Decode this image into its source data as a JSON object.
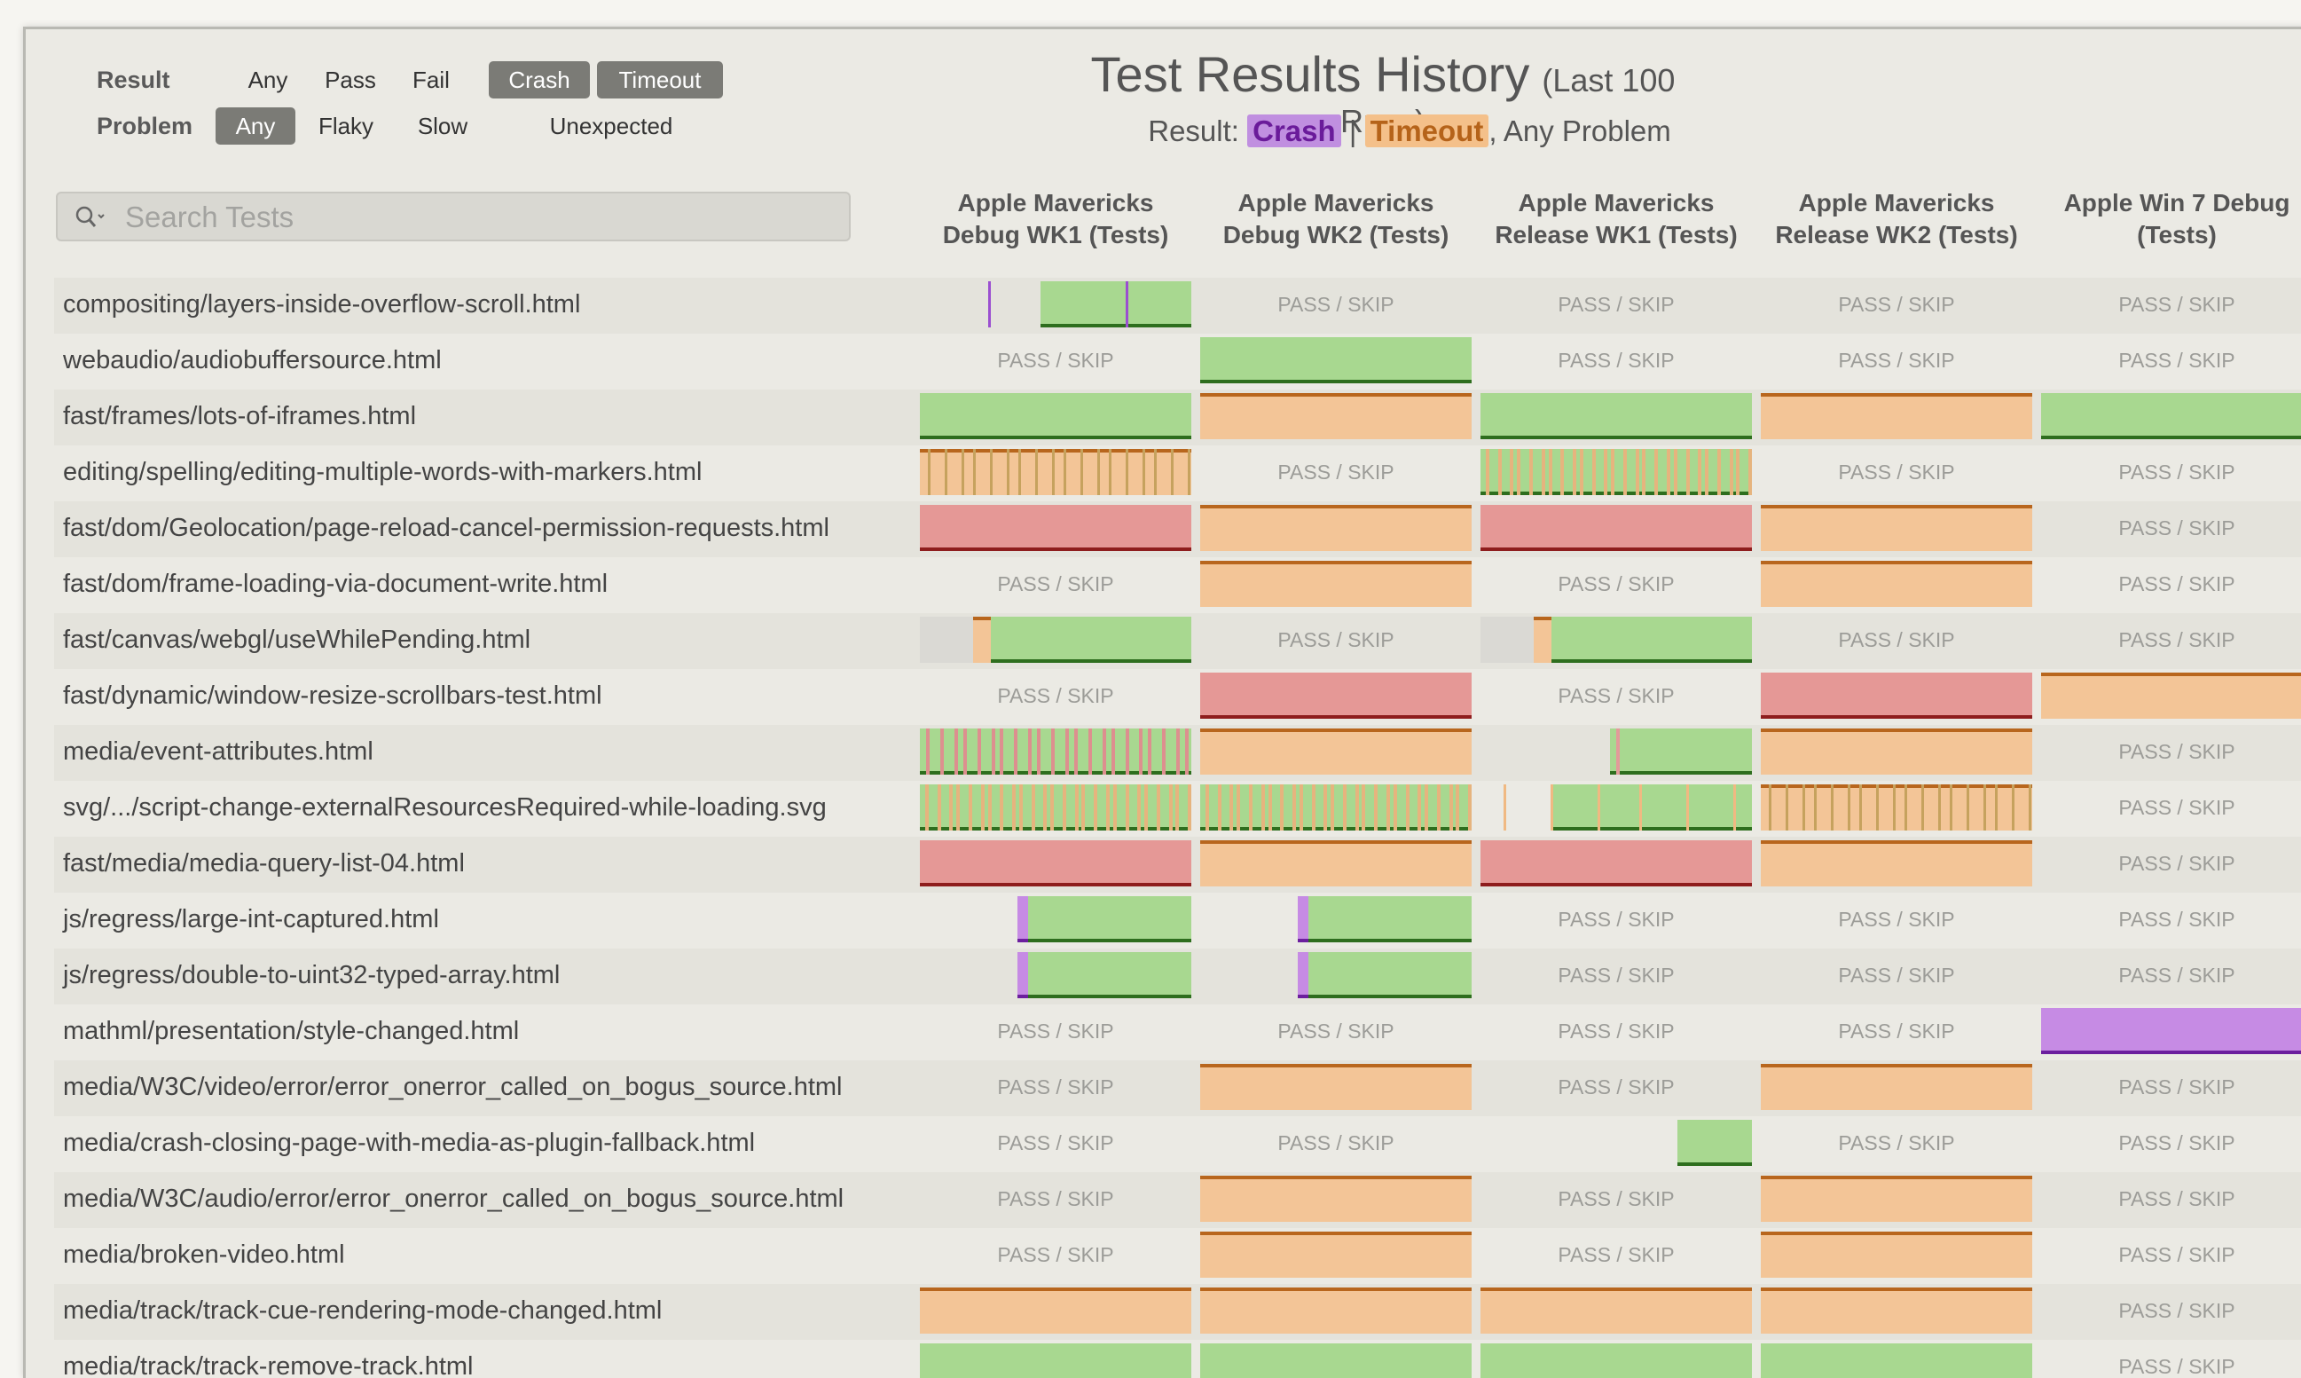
{
  "filters": {
    "result_label": "Result",
    "result_options": [
      "Any",
      "Pass",
      "Fail",
      "Crash",
      "Timeout"
    ],
    "result_selected": [
      "Crash",
      "Timeout"
    ],
    "problem_label": "Problem",
    "problem_options": [
      "Any",
      "Flaky",
      "Slow",
      "Unexpected"
    ],
    "problem_selected": [
      "Any"
    ]
  },
  "header": {
    "title": "Test Results History",
    "title_sub": "(Last 100 Runs)",
    "summary_prefix": "Result:",
    "summary_crash": "Crash",
    "summary_sep": "|",
    "summary_timeout": "Timeout",
    "summary_suffix": ", Any Problem"
  },
  "search": {
    "placeholder": "Search Tests"
  },
  "columns": [
    [
      "Apple Mavericks",
      "Debug WK1 (Tests)"
    ],
    [
      "Apple Mavericks",
      "Debug WK2 (Tests)"
    ],
    [
      "Apple Mavericks",
      "Release WK1 (Tests)"
    ],
    [
      "Apple Mavericks",
      "Release WK2 (Tests)"
    ],
    [
      "Apple Win 7 Debug",
      "(Tests)"
    ]
  ],
  "pass_skip_label": "PASS / SKIP",
  "colors": {
    "green": "#a8d890",
    "orange": "#f3c597",
    "red": "#e59896",
    "purple": "#c68be4",
    "gray": "#dad9d4"
  },
  "tests": [
    {
      "name": "compositing/layers-inside-overflow-scroll.html",
      "cells": [
        "green-late",
        "skip",
        "skip",
        "skip",
        "skip"
      ]
    },
    {
      "name": "webaudio/audiobuffersource.html",
      "cells": [
        "skip",
        "green",
        "skip",
        "skip",
        "skip"
      ]
    },
    {
      "name": "fast/frames/lots-of-iframes.html",
      "cells": [
        "green",
        "orange",
        "green",
        "orange",
        "green"
      ]
    },
    {
      "name": "editing/spelling/editing-multiple-words-with-markers.html",
      "cells": [
        "orange-stripe",
        "skip",
        "green-stripe",
        "skip",
        "skip"
      ]
    },
    {
      "name": "fast/dom/Geolocation/page-reload-cancel-permission-requests.html",
      "cells": [
        "red",
        "orange",
        "red",
        "orange",
        "skip"
      ]
    },
    {
      "name": "fast/dom/frame-loading-via-document-write.html",
      "cells": [
        "skip",
        "orange",
        "skip",
        "orange",
        "skip"
      ]
    },
    {
      "name": "fast/canvas/webgl/useWhilePending.html",
      "cells": [
        "gray-green",
        "skip",
        "gray-green",
        "skip",
        "skip"
      ]
    },
    {
      "name": "fast/dynamic/window-resize-scrollbars-test.html",
      "cells": [
        "skip",
        "red",
        "skip",
        "red",
        "orange"
      ]
    },
    {
      "name": "media/event-attributes.html",
      "cells": [
        "green-red-stripe",
        "orange",
        "green-late2",
        "orange",
        "skip"
      ]
    },
    {
      "name": "svg/.../script-change-externalResourcesRequired-while-loading.svg",
      "cells": [
        "green-stripe",
        "green-stripe",
        "green-late3",
        "orange-stripe",
        "skip"
      ]
    },
    {
      "name": "fast/media/media-query-list-04.html",
      "cells": [
        "red",
        "orange",
        "red",
        "orange",
        "skip"
      ]
    },
    {
      "name": "js/regress/large-int-captured.html",
      "cells": [
        "green-purple",
        "green-purple",
        "skip",
        "skip",
        "skip"
      ]
    },
    {
      "name": "js/regress/double-to-uint32-typed-array.html",
      "cells": [
        "green-purple",
        "green-purple",
        "skip",
        "skip",
        "skip"
      ]
    },
    {
      "name": "mathml/presentation/style-changed.html",
      "cells": [
        "skip",
        "skip",
        "skip",
        "skip",
        "purple"
      ]
    },
    {
      "name": "media/W3C/video/error/error_onerror_called_on_bogus_source.html",
      "cells": [
        "skip",
        "orange",
        "skip",
        "orange",
        "skip"
      ]
    },
    {
      "name": "media/crash-closing-page-with-media-as-plugin-fallback.html",
      "cells": [
        "skip",
        "skip",
        "green-tail",
        "skip",
        "skip"
      ]
    },
    {
      "name": "media/W3C/audio/error/error_onerror_called_on_bogus_source.html",
      "cells": [
        "skip",
        "orange",
        "skip",
        "orange",
        "skip"
      ]
    },
    {
      "name": "media/broken-video.html",
      "cells": [
        "skip",
        "orange",
        "skip",
        "orange",
        "skip"
      ]
    },
    {
      "name": "media/track/track-cue-rendering-mode-changed.html",
      "cells": [
        "orange",
        "orange",
        "orange",
        "orange",
        "skip"
      ]
    },
    {
      "name": "media/track/track-remove-track.html",
      "cells": [
        "green",
        "green",
        "green",
        "green",
        "skip"
      ]
    }
  ]
}
